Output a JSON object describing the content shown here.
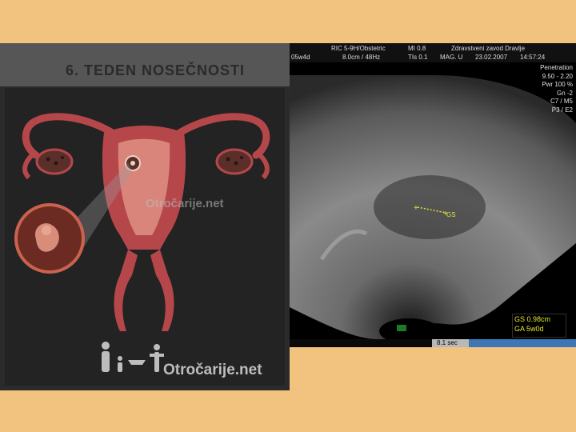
{
  "left_panel": {
    "title": "6. TEDEN NOSEČNOSTI",
    "watermark": "Otročarije.net"
  },
  "ultrasound": {
    "header": {
      "depth_fragment": "05w4d",
      "probe": "RIC 5-9H/Obstetric",
      "probe_settings": "8.0cm / 48Hz",
      "mi": "MI 0.8",
      "tis": "TIs 0.1",
      "clinic": "Zdravstveni zavod Dravlje",
      "mag": "MAG. U",
      "date": "23.02.2007",
      "time": "14:57:24"
    },
    "params": [
      "Penetration",
      "9.50 - 2.20",
      "Pwr 100 %",
      "Gn -2",
      "C7 / M5",
      "P3 / E2"
    ],
    "gs_label": "GS",
    "measurement": {
      "gs": "GS 0.98cm",
      "ga": "GA 5w0d"
    },
    "sweep_time": "8.1 sec"
  },
  "colors": {
    "background": "#f2c27f",
    "uterus": "#b5474b",
    "caliper": "#dfe040"
  }
}
